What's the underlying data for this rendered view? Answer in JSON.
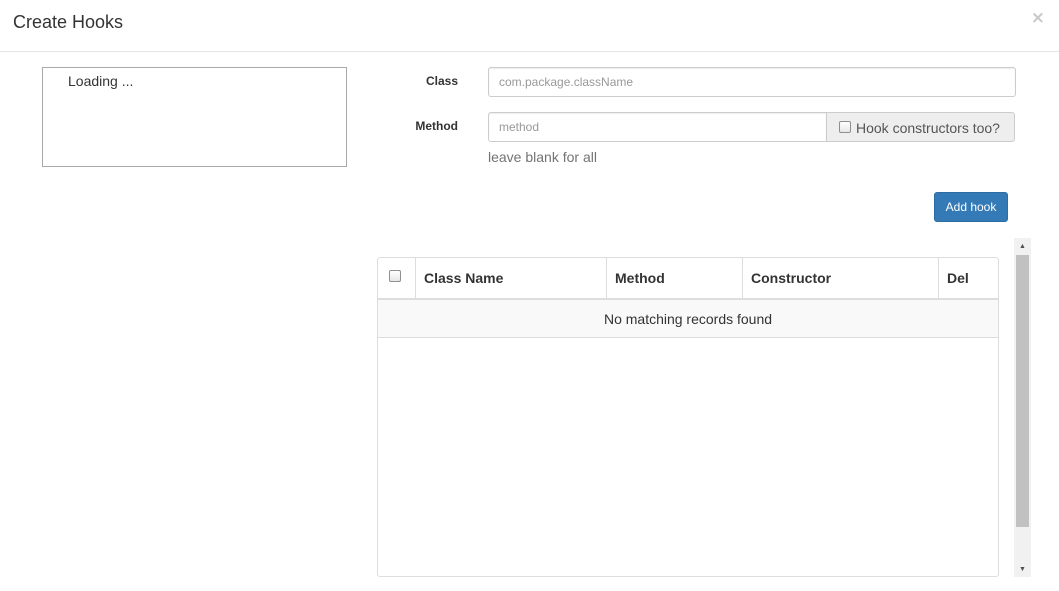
{
  "modal": {
    "title": "Create Hooks",
    "close_symbol": "×"
  },
  "tree": {
    "loading_text": "Loading ..."
  },
  "form": {
    "class_label": "Class",
    "class_placeholder": "com.package.className",
    "class_value": "",
    "method_label": "Method",
    "method_placeholder": "method",
    "method_value": "",
    "constructors_checkbox_label": "Hook constructors too?",
    "constructors_checked": false,
    "method_help": "leave blank for all",
    "add_button_label": "Add hook"
  },
  "table": {
    "columns": [
      "Class Name",
      "Method",
      "Constructor",
      "Del"
    ],
    "rows": [],
    "empty_message": "No matching records found"
  },
  "icons": {
    "close": "close-icon",
    "scroll_up": "arrow-up-icon",
    "scroll_down": "arrow-down-icon"
  },
  "colors": {
    "primary": "#337ab7",
    "border": "#dddddd",
    "help_text": "#737373"
  }
}
